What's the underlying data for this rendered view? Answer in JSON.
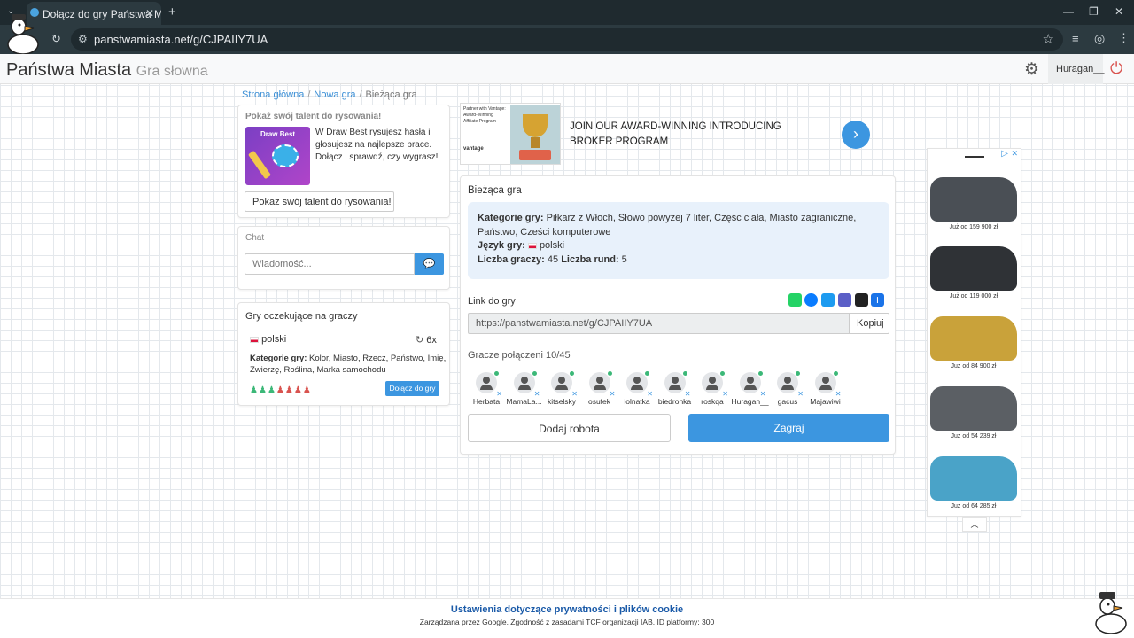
{
  "browser": {
    "tab_title": "Dołącz do gry Państwa Miasta",
    "url": "panstwamiasta.net/g/CJPAIIY7UA"
  },
  "header": {
    "brand": "Państwa Miasta",
    "brand_sub": "Gra słowna",
    "username": "Huragan__"
  },
  "breadcrumb": {
    "home": "Strona główna",
    "new_game": "Nowa gra",
    "current": "Bieżąca gra"
  },
  "promo": {
    "title": "Pokaż swój talent do rysowania!",
    "image_title": "Draw Best",
    "text": "W Draw Best rysujesz hasła i głosujesz na najlepsze prace. Dołącz i sprawdź, czy wygrasz!",
    "button": "Pokaż swój talent do rysowania!"
  },
  "chat": {
    "title": "Chat",
    "placeholder": "Wiadomość..."
  },
  "waiting": {
    "title": "Gry oczekujące na graczy",
    "language": "polski",
    "rounds": "6x",
    "categories_label": "Kategorie gry:",
    "categories": "Kolor, Miasto, Rzecz, Państwo, Imię, Zwierzę, Roślina, Marka samochodu",
    "join_button": "Dołącz do gry",
    "slots_filled": 3,
    "slots_total": 7
  },
  "banner_ad": {
    "text_line1": "JOIN OUR AWARD-WINNING INTRODUCING",
    "text_line2": "BROKER PROGRAM",
    "thumb_text": "Partner with Vantage: Award-Winning Affiliate Program",
    "thumb_brand": "vantage"
  },
  "game": {
    "title": "Bieżąca gra",
    "categories_label": "Kategorie gry:",
    "categories": "Piłkarz z Włoch, Słowo powyżej 7 liter, Częśc ciała, Miasto zagraniczne, Państwo, Cześci komputerowe",
    "language_label": "Język gry:",
    "language": "polski",
    "players_count_label": "Liczba graczy:",
    "players_count": "45",
    "rounds_label": "Liczba rund:",
    "rounds": "5",
    "link_label": "Link do gry",
    "link_value": "https://panstwamiasta.net/g/CJPAIIY7UA",
    "copy_button": "Kopiuj",
    "connected_label": "Gracze połączeni 10/45",
    "players": [
      "Herbata",
      "MamaLa...",
      "kitselsky",
      "osufek",
      "lolnatka",
      "biedronka",
      "roskqa",
      "Huragan__",
      "gacus",
      "Majawiwi"
    ],
    "add_robot_button": "Dodaj robota",
    "play_button": "Zagraj"
  },
  "side_ad": {
    "prices": [
      "Już od 159 900 zł",
      "Już od 119 000 zł",
      "Już od 84 900 zł",
      "Już od 54 239 zł",
      "Już od 64 285 zł"
    ],
    "car_colors": [
      "#4a4f55",
      "#2f3236",
      "#c9a23a",
      "#5b5f64",
      "#4aa3c8"
    ]
  },
  "footer": {
    "privacy_link": "Ustawienia dotyczące prywatności i plików cookie",
    "note": "Zarządzana przez Google. Zgodność z zasadami TCF organizacji IAB. ID platformy: 300"
  },
  "colors": {
    "accent": "#3c96e0",
    "online": "#3cb878",
    "seat_taken": "#3cb878",
    "seat_free": "#d9534f"
  }
}
